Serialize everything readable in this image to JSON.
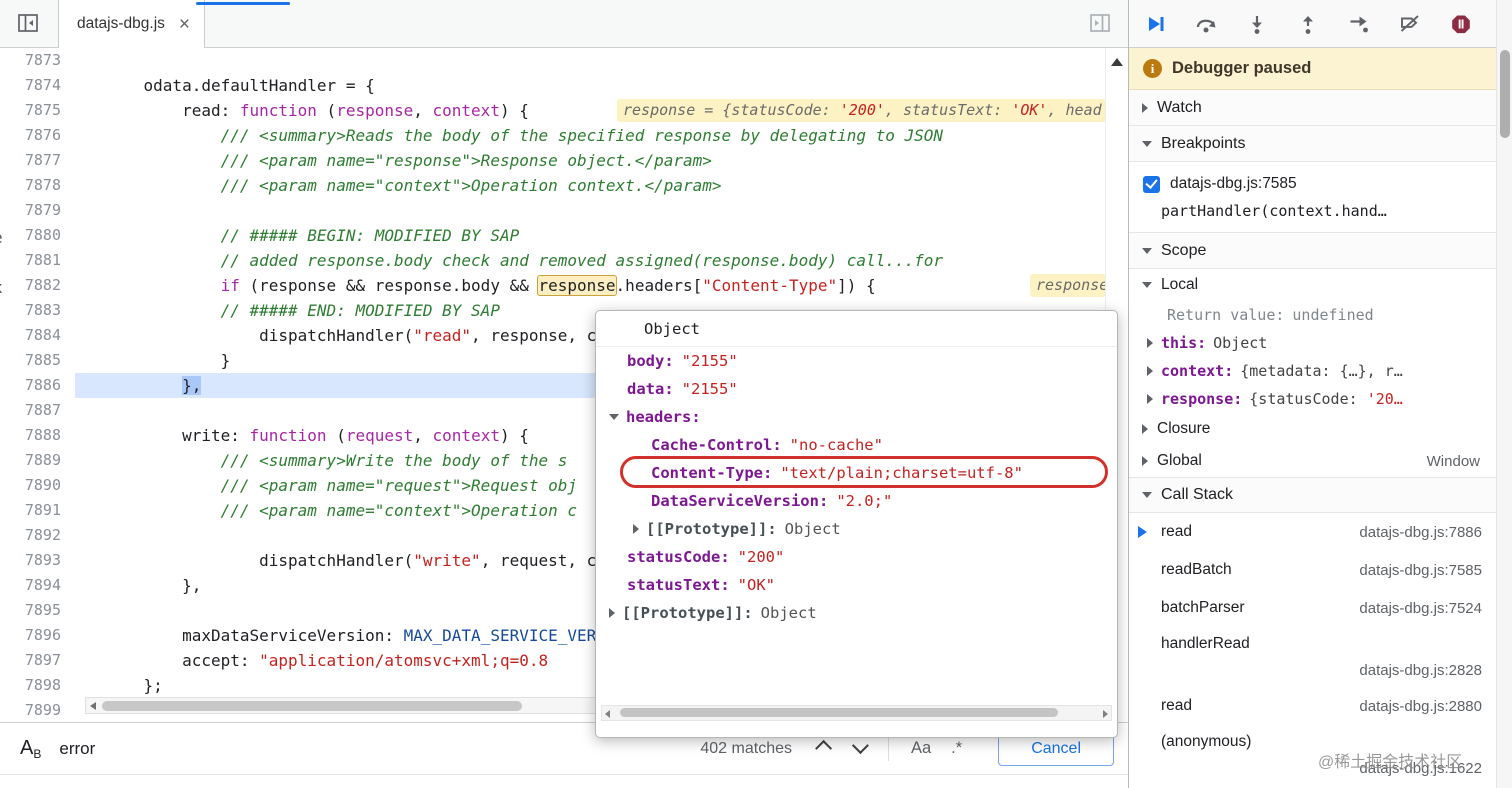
{
  "tabbar": {
    "tab_title": "datajs-dbg.js",
    "close_glyph": "×"
  },
  "editor": {
    "lines": [
      {
        "n": "7873",
        "p": []
      },
      {
        "n": "7874",
        "p": [
          {
            "c": "d",
            "t": "    odata.defaultHandler = {"
          }
        ]
      },
      {
        "n": "7875",
        "p": [
          {
            "c": "d",
            "t": "        read: "
          },
          {
            "c": "k",
            "t": "function"
          },
          {
            "c": "d",
            "t": " ("
          },
          {
            "c": "k",
            "t": "response"
          },
          {
            "c": "d",
            "t": ", "
          },
          {
            "c": "k",
            "t": "context"
          },
          {
            "c": "d",
            "t": ") {"
          }
        ]
      },
      {
        "n": "7876",
        "p": [
          {
            "c": "c",
            "t": "            /// <summary>Reads the body of the specified response by delegating to JSON"
          }
        ]
      },
      {
        "n": "7877",
        "p": [
          {
            "c": "c",
            "t": "            /// <param name=\"response\">Response object.</param>"
          }
        ]
      },
      {
        "n": "7878",
        "p": [
          {
            "c": "c",
            "t": "            /// <param name=\"context\">Operation context.</param>"
          }
        ]
      },
      {
        "n": "7879",
        "p": []
      },
      {
        "n": "7880",
        "p": [
          {
            "c": "c",
            "t": "            // ##### BEGIN: MODIFIED BY SAP"
          }
        ]
      },
      {
        "n": "7881",
        "p": [
          {
            "c": "c",
            "t": "            // added response.body check and removed assigned(response.body) call...for"
          }
        ]
      },
      {
        "n": "7882",
        "p": [
          {
            "c": "d",
            "t": "            "
          },
          {
            "c": "k",
            "t": "if"
          },
          {
            "c": "d",
            "t": " (response && response.body && "
          },
          {
            "c": "hl",
            "t": "response"
          },
          {
            "c": "d",
            "t": ".headers["
          },
          {
            "c": "s",
            "t": "\"Content-Type\""
          },
          {
            "c": "d",
            "t": "]) {"
          }
        ]
      },
      {
        "n": "7883",
        "p": [
          {
            "c": "c",
            "t": "            // ##### END: MODIFIED BY SAP"
          }
        ]
      },
      {
        "n": "7884",
        "p": [
          {
            "c": "d",
            "t": "                dispatchHandler("
          },
          {
            "c": "s",
            "t": "\"read\""
          },
          {
            "c": "d",
            "t": ", response, context);"
          }
        ]
      },
      {
        "n": "7885",
        "p": [
          {
            "c": "d",
            "t": "            }"
          }
        ]
      },
      {
        "n": "7886",
        "cur": true,
        "p": [
          {
            "c": "d",
            "t": "        "
          },
          {
            "c": "cur",
            "t": "},"
          }
        ]
      },
      {
        "n": "7887",
        "p": []
      },
      {
        "n": "7888",
        "p": [
          {
            "c": "d",
            "t": "        write: "
          },
          {
            "c": "k",
            "t": "function"
          },
          {
            "c": "d",
            "t": " ("
          },
          {
            "c": "k",
            "t": "request"
          },
          {
            "c": "d",
            "t": ", "
          },
          {
            "c": "k",
            "t": "context"
          },
          {
            "c": "d",
            "t": ") {"
          }
        ]
      },
      {
        "n": "7889",
        "p": [
          {
            "c": "c",
            "t": "            /// <summary>Write the body of the s"
          }
        ]
      },
      {
        "n": "7890",
        "p": [
          {
            "c": "c",
            "t": "            /// <param name=\"request\">Request obj"
          }
        ]
      },
      {
        "n": "7891",
        "p": [
          {
            "c": "c",
            "t": "            /// <param name=\"context\">Operation c"
          }
        ]
      },
      {
        "n": "7892",
        "p": []
      },
      {
        "n": "7893",
        "p": [
          {
            "c": "d",
            "t": "                dispatchHandler("
          },
          {
            "c": "s",
            "t": "\"write\""
          },
          {
            "c": "d",
            "t": ", request, context);"
          }
        ]
      },
      {
        "n": "7894",
        "p": [
          {
            "c": "d",
            "t": "        },"
          }
        ]
      },
      {
        "n": "7895",
        "p": []
      },
      {
        "n": "7896",
        "p": [
          {
            "c": "d",
            "t": "        maxDataServiceVersion: "
          },
          {
            "c": "v",
            "t": "MAX_DATA_SERVICE_VERSION"
          },
          {
            "c": "d",
            "t": ","
          }
        ]
      },
      {
        "n": "7897",
        "p": [
          {
            "c": "d",
            "t": "        accept: "
          },
          {
            "c": "s",
            "t": "\"application/atomsvc+xml;q=0.8"
          }
        ]
      },
      {
        "n": "7898",
        "p": [
          {
            "c": "d",
            "t": "    };"
          }
        ]
      },
      {
        "n": "7899",
        "p": []
      }
    ],
    "chips": [
      {
        "line": "7875",
        "parts": [
          {
            "c": "ep",
            "t": "response = {statusCode: "
          },
          {
            "c": "es",
            "t": "'200'"
          },
          {
            "c": "ep",
            "t": ", statusText: "
          },
          {
            "c": "es",
            "t": "'OK'"
          },
          {
            "c": "ep",
            "t": ", head"
          }
        ]
      },
      {
        "line": "7882",
        "parts": [
          {
            "c": "ep",
            "t": "response = {st"
          }
        ]
      }
    ],
    "edge_fragments": [
      {
        "t": "e"
      },
      {
        "t": "x"
      }
    ]
  },
  "popup": {
    "title": "Object",
    "rows": [
      {
        "lvl": 1,
        "key": "body",
        "val": "\"2155\"",
        "vt": "str"
      },
      {
        "lvl": 1,
        "key": "data",
        "val": "\"2155\"",
        "vt": "str"
      },
      {
        "lvl": 1,
        "key": "headers",
        "arrow": "open"
      },
      {
        "lvl": 2,
        "key": "Cache-Control",
        "val": "\"no-cache\"",
        "vt": "str"
      },
      {
        "lvl": 2,
        "key": "Content-Type",
        "val": "\"text/plain;charset=utf-8\"",
        "vt": "str",
        "annotated": true
      },
      {
        "lvl": 2,
        "key": "DataServiceVersion",
        "val": "\"2.0;\"",
        "vt": "str"
      },
      {
        "lvl": 2,
        "key": "[[Prototype]]",
        "val": "Object",
        "vt": "obj",
        "arrow": "closed",
        "internal": true
      },
      {
        "lvl": 1,
        "key": "statusCode",
        "val": "\"200\"",
        "vt": "str"
      },
      {
        "lvl": 1,
        "key": "statusText",
        "val": "\"OK\"",
        "vt": "str"
      },
      {
        "lvl": 1,
        "key": "[[Prototype]]",
        "val": "Object",
        "vt": "obj",
        "arrow": "closed",
        "internal": true
      }
    ]
  },
  "search": {
    "query": "error",
    "matches": "402 matches",
    "case_label": "Aa",
    "regex_label": ".*",
    "cancel_label": "Cancel"
  },
  "sidebar": {
    "paused_label": "Debugger paused",
    "info_glyph": "i",
    "watch_label": "Watch",
    "breakpoints_label": "Breakpoints",
    "breakpoint": {
      "location": "datajs-dbg.js:7585",
      "snippet": "partHandler(context.hand…"
    },
    "scope_label": "Scope",
    "scope_rows": [
      {
        "type": "group",
        "label": "Local",
        "open": true
      },
      {
        "type": "ret",
        "key": "Return value:",
        "value": "undefined"
      },
      {
        "type": "kv",
        "key": "this",
        "parts": [
          {
            "c": "pv",
            "t": "Object"
          }
        ]
      },
      {
        "type": "kv",
        "key": "context",
        "parts": [
          {
            "c": "pv",
            "t": "{metadata: {…}, r…"
          }
        ]
      },
      {
        "type": "kv",
        "key": "response",
        "parts": [
          {
            "c": "pv",
            "t": "{statusCode: "
          },
          {
            "c": "pvs",
            "t": "'20…"
          }
        ]
      },
      {
        "type": "group",
        "label": "Closure",
        "open": false
      },
      {
        "type": "group",
        "label": "Global",
        "open": false,
        "right": "Window"
      }
    ],
    "callstack_label": "Call Stack",
    "call_stack": [
      {
        "name": "read",
        "file": "datajs-dbg.js:7886",
        "active": true
      },
      {
        "name": "readBatch",
        "file": "datajs-dbg.js:7585"
      },
      {
        "name": "batchParser",
        "file": "datajs-dbg.js:7524"
      },
      {
        "name": "handlerRead",
        "file": "datajs-dbg.js:2828",
        "twoline": true
      },
      {
        "name": "read",
        "file": "datajs-dbg.js:2880"
      },
      {
        "name": "(anonymous)",
        "file": "datajs-dbg.js:1622",
        "twoline": true
      }
    ]
  },
  "watermark": "@稀土掘金技术社区"
}
